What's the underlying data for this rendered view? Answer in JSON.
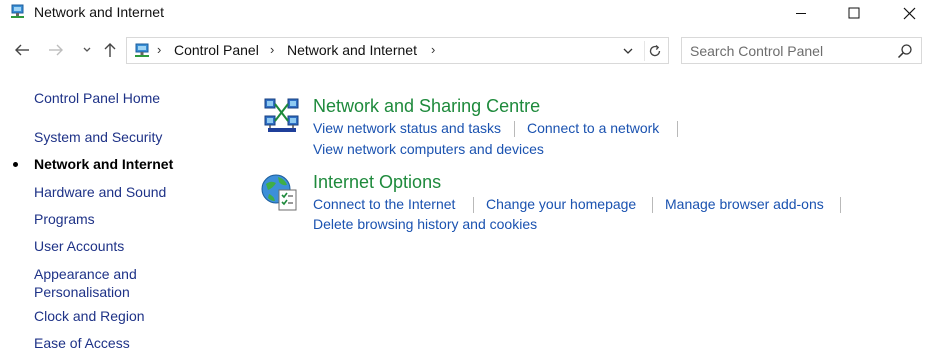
{
  "window": {
    "title": "Network and Internet",
    "controls": {
      "minimize": "minimize",
      "maximize": "maximize",
      "close": "close"
    }
  },
  "address": {
    "breadcrumbs": [
      "Control Panel",
      "Network and Internet"
    ]
  },
  "search": {
    "placeholder": "Search Control Panel"
  },
  "sidebar": {
    "home": "Control Panel Home",
    "items": [
      {
        "label": "System and Security",
        "current": false
      },
      {
        "label": "Network and Internet",
        "current": true
      },
      {
        "label": "Hardware and Sound",
        "current": false
      },
      {
        "label": "Programs",
        "current": false
      },
      {
        "label": "User Accounts",
        "current": false
      },
      {
        "label": "Appearance and",
        "label2": "Personalisation",
        "current": false
      },
      {
        "label": "Clock and Region",
        "current": false
      },
      {
        "label": "Ease of Access",
        "current": false
      }
    ]
  },
  "categories": [
    {
      "title": "Network and Sharing Centre",
      "icon": "network-sharing-icon",
      "tasks": [
        "View network status and tasks",
        "Connect to a network",
        "View network computers and devices"
      ]
    },
    {
      "title": "Internet Options",
      "icon": "internet-options-icon",
      "tasks": [
        "Connect to the Internet",
        "Change your homepage",
        "Manage browser add-ons",
        "Delete browsing history and cookies"
      ]
    }
  ],
  "colors": {
    "category_title": "#1e8a3c",
    "task_link": "#1a52b0",
    "nav_link": "#1e3287"
  }
}
